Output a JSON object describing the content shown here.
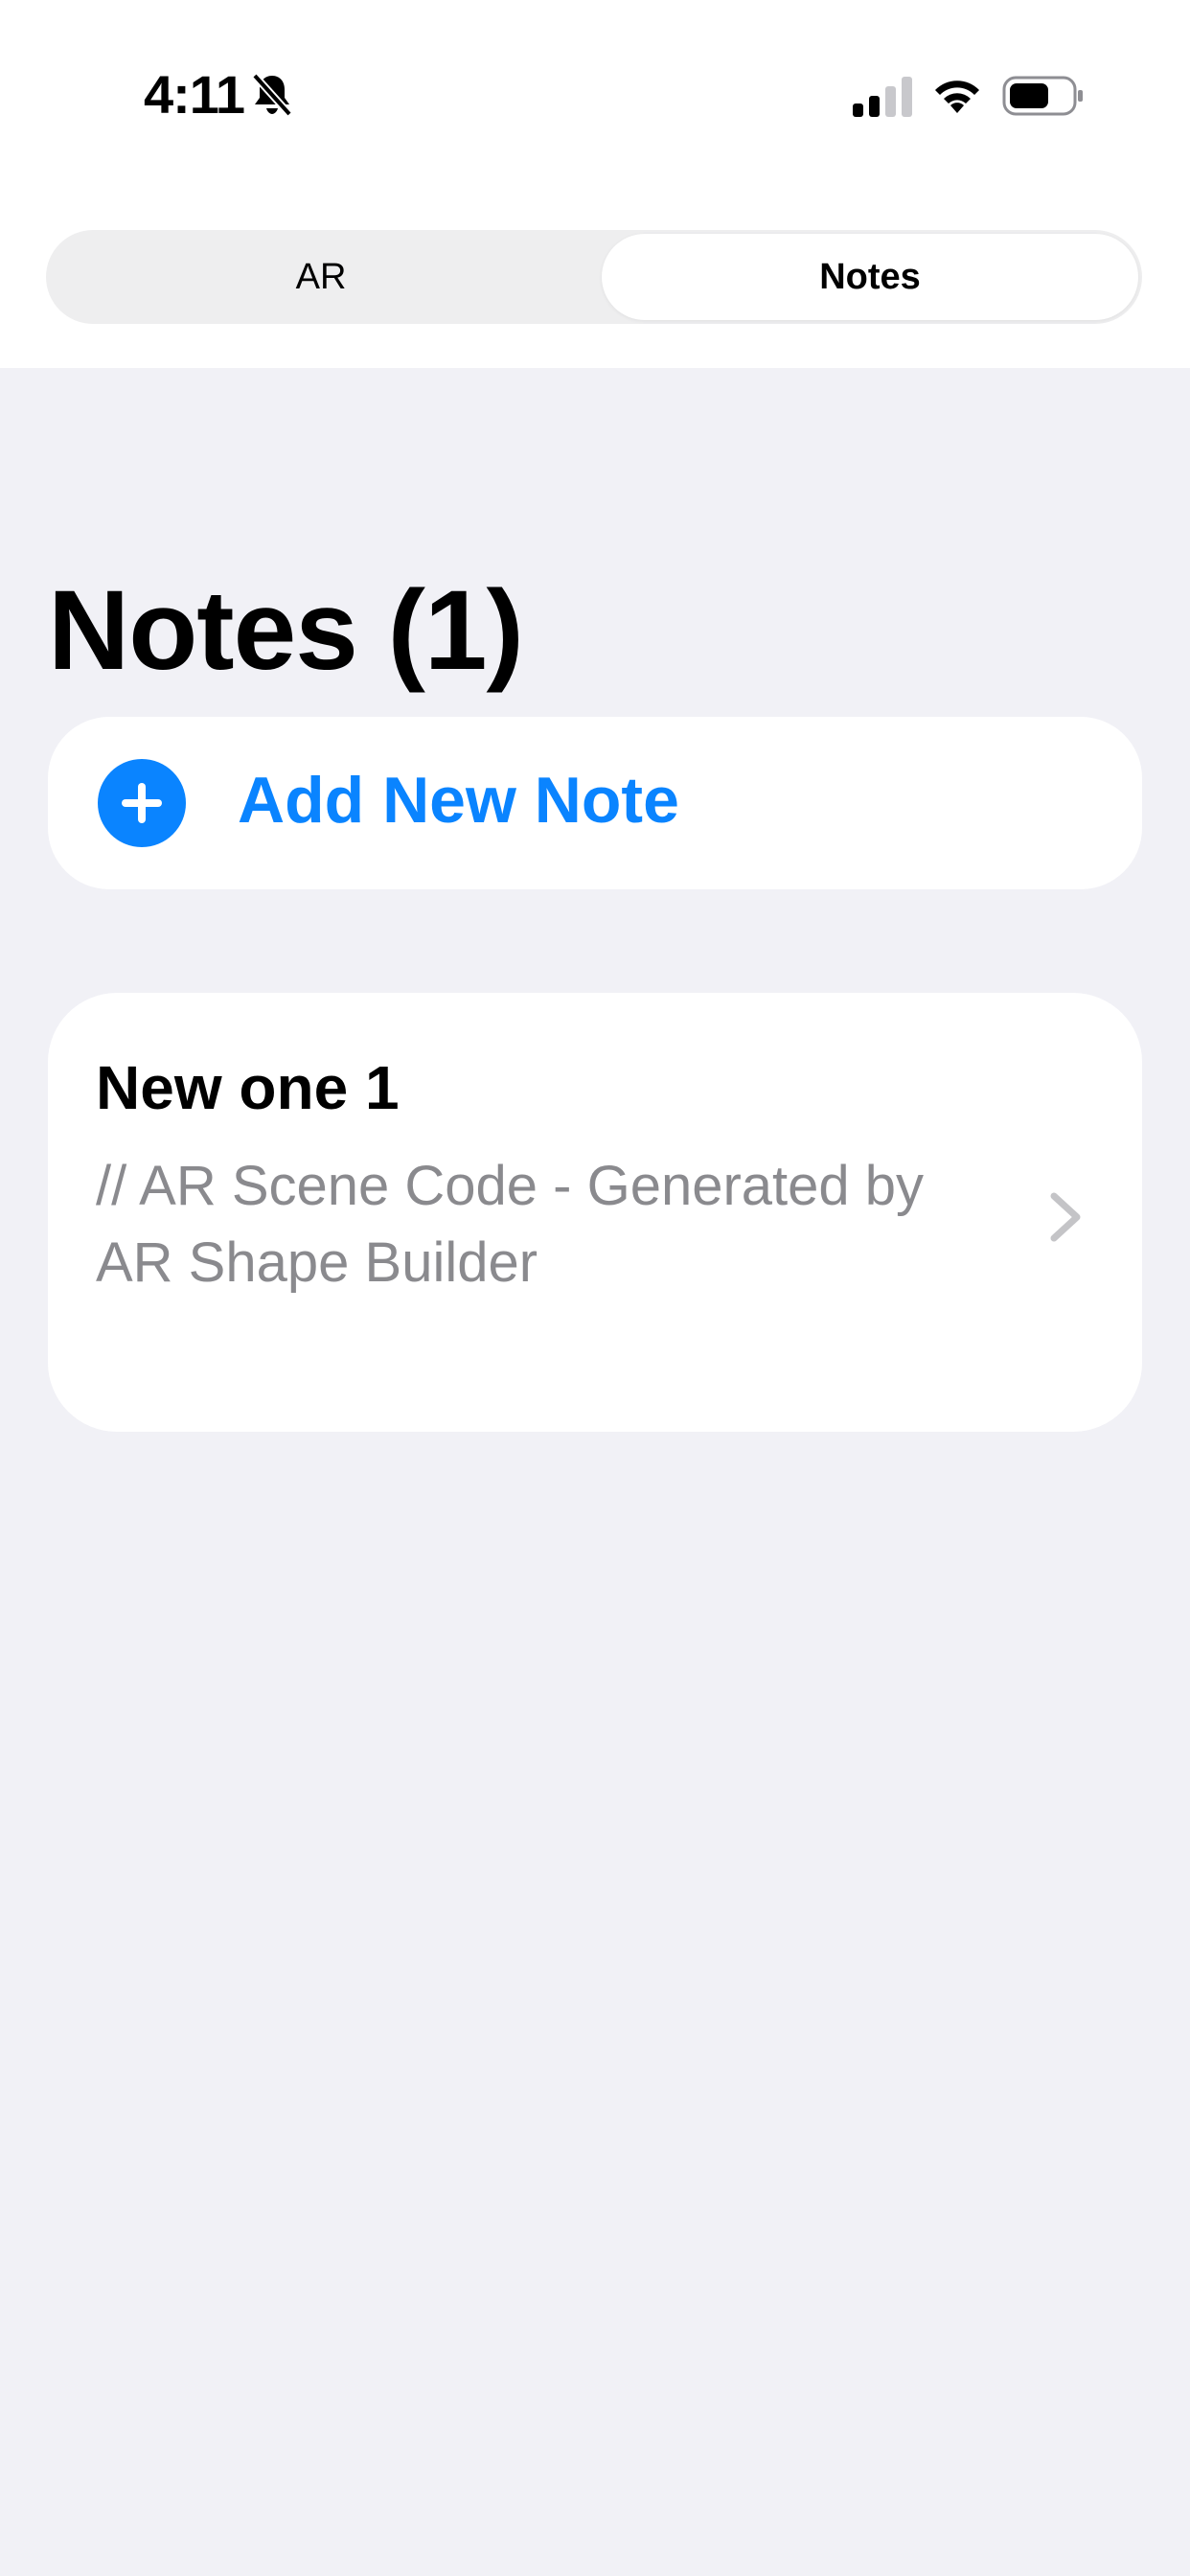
{
  "status_bar": {
    "time": "4:11",
    "icons": [
      "bell-slash-icon",
      "cellular-signal-icon",
      "wifi-icon",
      "battery-icon"
    ]
  },
  "segmented_control": {
    "tabs": [
      {
        "label": "AR",
        "selected": false
      },
      {
        "label": "Notes",
        "selected": true
      }
    ]
  },
  "main": {
    "title": "Notes (1)",
    "add_button": {
      "label": "Add New Note",
      "icon": "plus-circle-icon"
    },
    "notes": [
      {
        "title": "New one 1",
        "preview": "// AR Scene Code - Generated by AR Shape Builder"
      }
    ]
  },
  "colors": {
    "accent": "#0A84FF",
    "background": "#F1F1F6",
    "card": "#FFFFFF",
    "secondary_text": "#8A8A8E"
  }
}
